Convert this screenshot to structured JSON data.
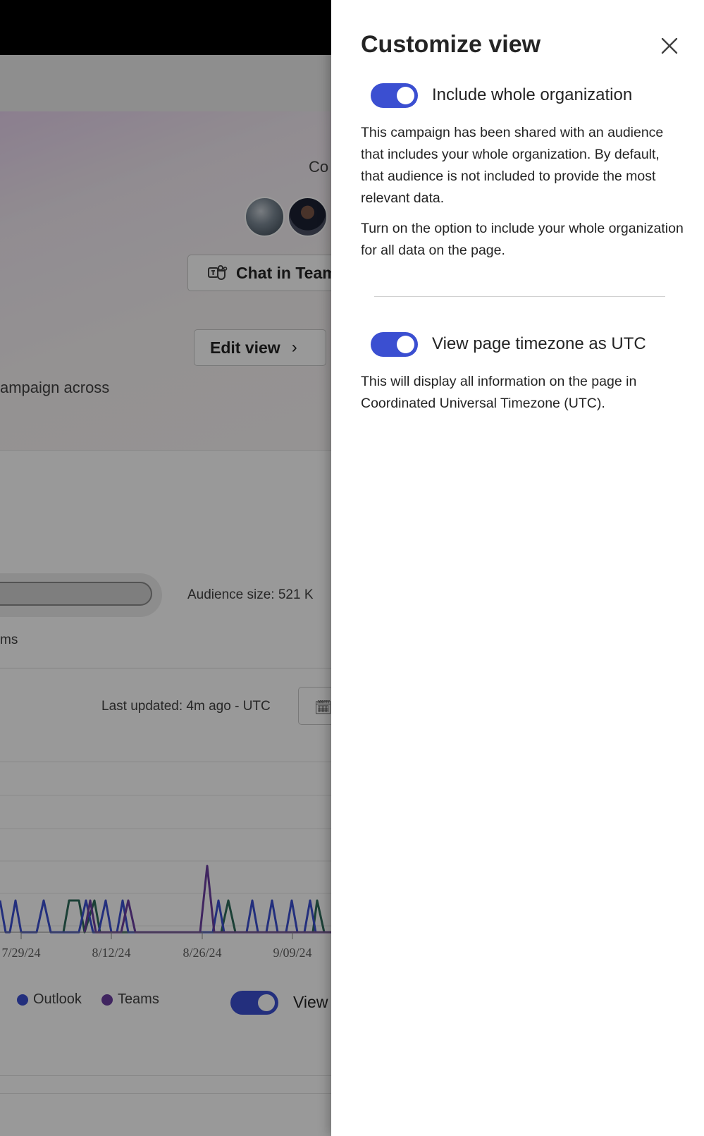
{
  "background": {
    "hero": {
      "co_fragment": "Co",
      "chat_button_label": "Chat in Team",
      "edit_view_label": "Edit view",
      "description_fragment": "ampaign across"
    },
    "audience_size": "Audience size: 521 K",
    "teams_fragment": "ms",
    "last_updated": "Last updated: 4m ago - UTC",
    "chart": {
      "x_ticks": [
        "7/29/24",
        "8/12/24",
        "8/26/24",
        "9/09/24"
      ]
    },
    "legend": [
      {
        "label": "Outlook",
        "color": "#3b4fd1"
      },
      {
        "label": "Teams",
        "color": "#6b3fa0"
      }
    ],
    "view_fragment": "View"
  },
  "chart_data": {
    "type": "line",
    "x_tick_labels": [
      "7/29/24",
      "8/12/24",
      "8/26/24",
      "9/09/24"
    ],
    "series": [
      {
        "name": "Outlook",
        "color": "#3b4fd1"
      },
      {
        "name": "Teams",
        "color": "#6b3fa0"
      }
    ],
    "grid": true,
    "legend": "bottom-left"
  },
  "panel": {
    "title": "Customize view",
    "options": [
      {
        "label": "Include whole organization",
        "enabled": true,
        "description": "This campaign has been shared with an audience that includes your whole organization. By default, that audience is not included to provide the most relevant data.",
        "description2": "Turn on the option to include your whole organization for all data on the page."
      },
      {
        "label": "View page timezone as UTC",
        "enabled": true,
        "description": "This will display all information on the page in Coordinated Universal Timezone (UTC)."
      }
    ]
  },
  "colors": {
    "accent": "#3b4fd1",
    "teams": "#6b3fa0",
    "green_series": "#2e6b5a"
  }
}
